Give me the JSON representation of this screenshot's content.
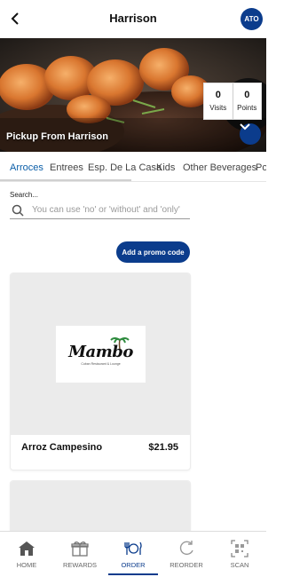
{
  "header": {
    "title": "Harrison",
    "avatar_initials": "ATO"
  },
  "hero": {
    "pickup_text": "Pickup From Harrison",
    "stats": [
      {
        "value": "0",
        "label": "Visits"
      },
      {
        "value": "0",
        "label": "Points"
      }
    ]
  },
  "tabs": [
    {
      "label": "Arroces",
      "active": true
    },
    {
      "label": "Entrees",
      "active": false
    },
    {
      "label": "Esp. De La Casa",
      "active": false
    },
    {
      "label": "Kids",
      "active": false
    },
    {
      "label": "Other Beverages",
      "active": false
    },
    {
      "label": "Postres",
      "active": false
    }
  ],
  "search": {
    "label": "Search...",
    "placeholder": "You can use 'no' or 'without' and 'only'",
    "value": ""
  },
  "promo": {
    "label": "Add a promo code"
  },
  "menu_items": [
    {
      "name": "Arroz Campesino",
      "price": "$21.95",
      "logo_text": "Mambo",
      "logo_sub": "Cuban Restaurant & Lounge"
    }
  ],
  "nav": [
    {
      "label": "HOME",
      "icon": "home-icon",
      "active": false
    },
    {
      "label": "REWARDS",
      "icon": "gift-icon",
      "active": false
    },
    {
      "label": "ORDER",
      "icon": "dining-icon",
      "active": true
    },
    {
      "label": "REORDER",
      "icon": "refresh-icon",
      "active": false
    },
    {
      "label": "SCAN",
      "icon": "qr-scan-icon",
      "active": false
    }
  ],
  "colors": {
    "brand": "#0b3c8c",
    "tab_active": "#0b5ea8",
    "muted": "#666666"
  }
}
